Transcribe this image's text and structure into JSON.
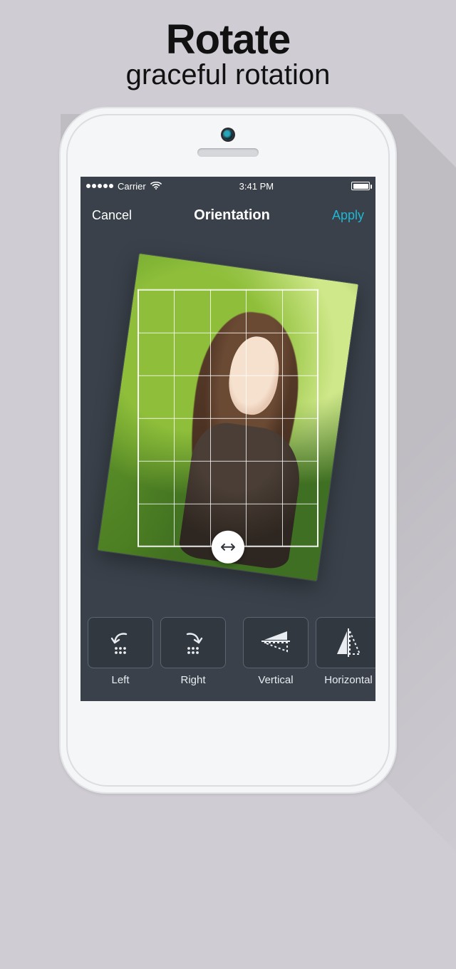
{
  "promo": {
    "title": "Rotate",
    "subtitle": "graceful rotation"
  },
  "statusbar": {
    "carrier": "Carrier",
    "time": "3:41 PM"
  },
  "navbar": {
    "cancel": "Cancel",
    "title": "Orientation",
    "apply": "Apply"
  },
  "toolbar": {
    "left": {
      "label": "Left"
    },
    "right": {
      "label": "Right"
    },
    "vertical": {
      "label": "Vertical"
    },
    "horizontal": {
      "label": "Horizontal"
    }
  },
  "colors": {
    "accent": "#1fb7d3"
  }
}
